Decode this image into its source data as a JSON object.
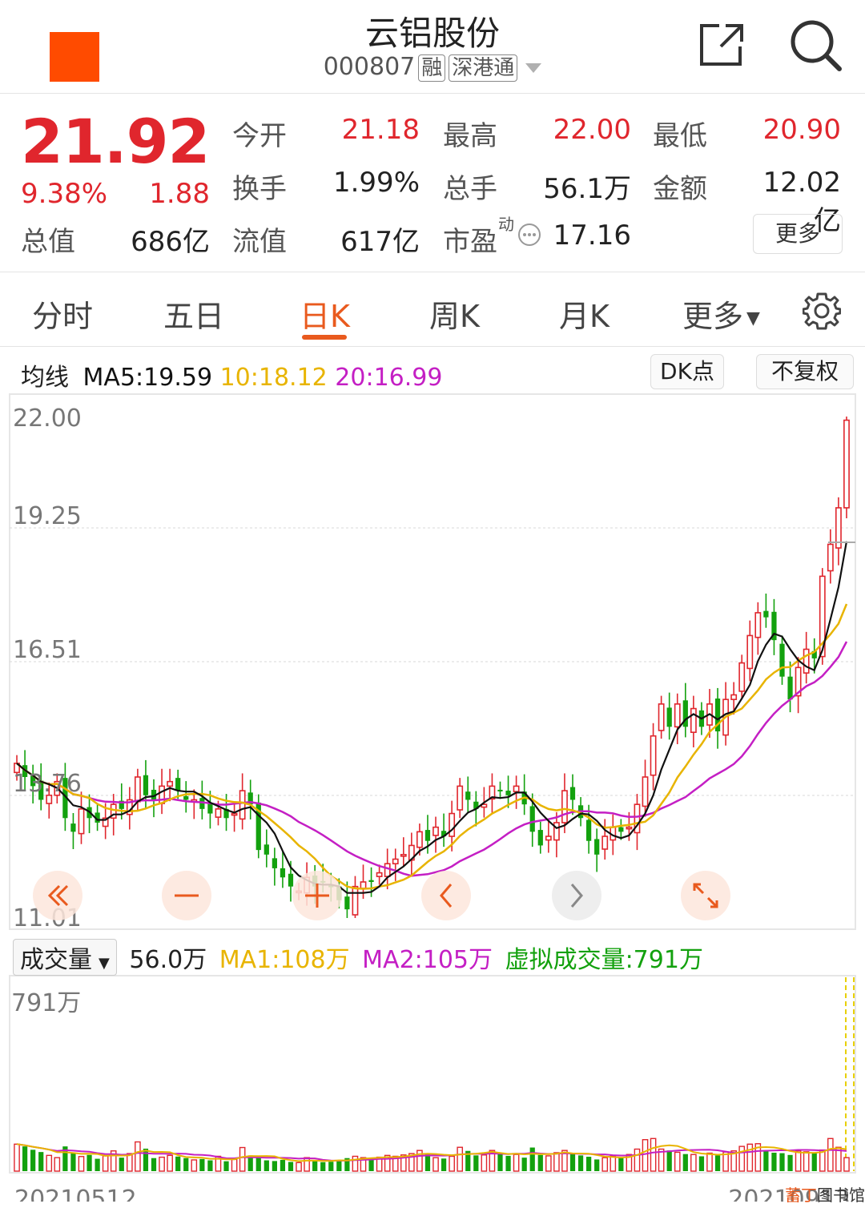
{
  "header": {
    "title": "云铝股份",
    "code": "000807",
    "tags": [
      "融",
      "深港通"
    ]
  },
  "quote": {
    "price": "21.92",
    "change_pct": "9.38%",
    "change": "1.88",
    "total_value_label": "总值",
    "total_value": "686亿",
    "stats": [
      {
        "label": "今开",
        "value": "21.18",
        "red": true
      },
      {
        "label": "最高",
        "value": "22.00",
        "red": true
      },
      {
        "label": "最低",
        "value": "20.90",
        "red": true
      },
      {
        "label": "换手",
        "value": "1.99%",
        "red": false
      },
      {
        "label": "总手",
        "value": "56.1万",
        "red": false
      },
      {
        "label": "金额",
        "value": "12.02亿",
        "red": false
      },
      {
        "label": "流值",
        "value": "617亿",
        "red": false
      },
      {
        "label": "市盈",
        "value": "17.16",
        "red": false
      }
    ],
    "pe_superscript": "动",
    "more": "更多"
  },
  "tabs": [
    "分时",
    "五日",
    "日K",
    "周K",
    "月K",
    "更多"
  ],
  "ma_legend": {
    "label": "均线",
    "ma5": "MA5:19.59",
    "ma10": "10:18.12",
    "ma20": "20:16.99",
    "btn_dk": "DK点",
    "btn_adjust": "不复权"
  },
  "volume_legend": {
    "select": "成交量",
    "vol": "56.0万",
    "ma1": "MA1:108万",
    "ma2": "MA2:105万",
    "virtual": "虚拟成交量:791万"
  },
  "colors": {
    "up": "#e0262d",
    "down": "#13a10e",
    "ma5": "#111111",
    "ma10": "#e8b400",
    "ma20": "#c41fc4",
    "accent": "#e95a1e"
  },
  "chart_data": {
    "type": "candlestick",
    "y_ticks": [
      "22.00",
      "19.25",
      "16.51",
      "13.76",
      "11.01"
    ],
    "ylim": [
      11.01,
      22.0
    ],
    "volume_max_label": "791万",
    "x_start": "20210512",
    "x_end": "20210913",
    "close": [
      14.4,
      14.1,
      13.9,
      13.6,
      13.7,
      14.0,
      13.2,
      12.9,
      13.4,
      13.2,
      13.1,
      13.2,
      13.5,
      13.4,
      13.6,
      14.1,
      13.7,
      13.6,
      13.9,
      14.0,
      13.8,
      13.6,
      13.6,
      13.4,
      13.3,
      13.4,
      13.2,
      13.3,
      13.8,
      13.5,
      12.5,
      12.4,
      12.1,
      11.9,
      11.7,
      11.6,
      11.9,
      11.7,
      11.8,
      11.7,
      11.4,
      11.2,
      11.7,
      11.8,
      11.8,
      12.0,
      12.2,
      12.3,
      12.4,
      12.6,
      12.9,
      12.7,
      13.0,
      12.8,
      13.3,
      13.9,
      13.6,
      13.4,
      13.5,
      13.9,
      13.8,
      13.7,
      13.9,
      13.5,
      12.9,
      12.6,
      12.8,
      13.1,
      13.8,
      13.6,
      13.2,
      12.7,
      12.4,
      12.8,
      13.0,
      12.9,
      13.0,
      13.5,
      14.1,
      15.0,
      15.7,
      15.2,
      15.7,
      15.2,
      15.6,
      15.2,
      15.7,
      15.1,
      15.8,
      15.9,
      16.6,
      17.2,
      17.7,
      17.6,
      17.1,
      16.3,
      15.8,
      16.5,
      16.9,
      16.7,
      18.5,
      19.2,
      20.0,
      21.92
    ],
    "volume": [
      120,
      110,
      95,
      85,
      70,
      60,
      110,
      80,
      65,
      72,
      55,
      68,
      90,
      60,
      78,
      130,
      100,
      58,
      62,
      70,
      65,
      58,
      50,
      54,
      48,
      66,
      44,
      52,
      105,
      70,
      62,
      48,
      45,
      50,
      41,
      38,
      60,
      48,
      40,
      42,
      50,
      58,
      66,
      60,
      54,
      62,
      70,
      66,
      72,
      78,
      92,
      80,
      60,
      56,
      66,
      106,
      90,
      70,
      72,
      92,
      80,
      68,
      74,
      60,
      105,
      72,
      68,
      82,
      92,
      80,
      70,
      64,
      52,
      60,
      68,
      58,
      74,
      98,
      140,
      145,
      98,
      92,
      84,
      76,
      74,
      66,
      80,
      70,
      85,
      90,
      110,
      120,
      122,
      92,
      82,
      80,
      72,
      90,
      86,
      80,
      94,
      145,
      106,
      60
    ]
  }
}
